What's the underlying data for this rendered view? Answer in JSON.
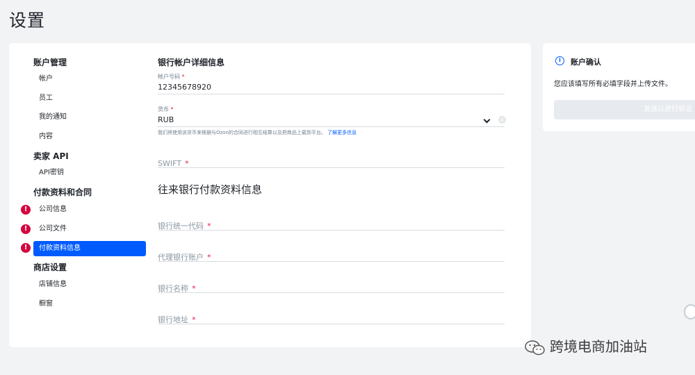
{
  "page_title": "设置",
  "sidebar": {
    "groups": [
      {
        "title": "账户管理",
        "items": [
          {
            "label": "帐户"
          },
          {
            "label": "员工"
          },
          {
            "label": "我的通知"
          },
          {
            "label": "内容"
          }
        ]
      },
      {
        "title": "卖家 API",
        "items": [
          {
            "label": "API密钥"
          }
        ]
      },
      {
        "title": "付款资料和合同",
        "items": [
          {
            "label": "公司信息",
            "alert": "!"
          },
          {
            "label": "公司文件",
            "alert": "!"
          },
          {
            "label": "付款资料信息",
            "alert": "!",
            "active": true
          }
        ]
      },
      {
        "title": "商店设置",
        "items": [
          {
            "label": "店铺信息"
          },
          {
            "label": "橱窗"
          }
        ]
      }
    ]
  },
  "main": {
    "bank_section_title": "银行帐户详细信息",
    "account_number": {
      "label": "帐户号码",
      "required": "*",
      "value": "12345678920"
    },
    "currency": {
      "label": "货币",
      "required": "*",
      "value": "RUB",
      "clear": "×"
    },
    "currency_hint": "我们将使用该货币来根据与Ozon的合同进行相互结算以及把商品上载到平台。",
    "currency_hint_link": "了解更多信息",
    "swift": {
      "placeholder": "SWIFT",
      "required": "*"
    },
    "correspondent_section_title": "往来银行付款资料信息",
    "fields": [
      {
        "placeholder": "银行统一代码",
        "required": "*"
      },
      {
        "placeholder": "代理银行账户",
        "required": "*"
      },
      {
        "placeholder": "银行名称",
        "required": "*"
      },
      {
        "placeholder": "银行地址",
        "required": "*"
      }
    ]
  },
  "confirm_card": {
    "info_icon": "i",
    "title": "账户确认",
    "description": "您应该填写所有必填字段并上传文件。",
    "button_label": "发送以进行验证"
  },
  "watermark": "跨境电商加油站"
}
